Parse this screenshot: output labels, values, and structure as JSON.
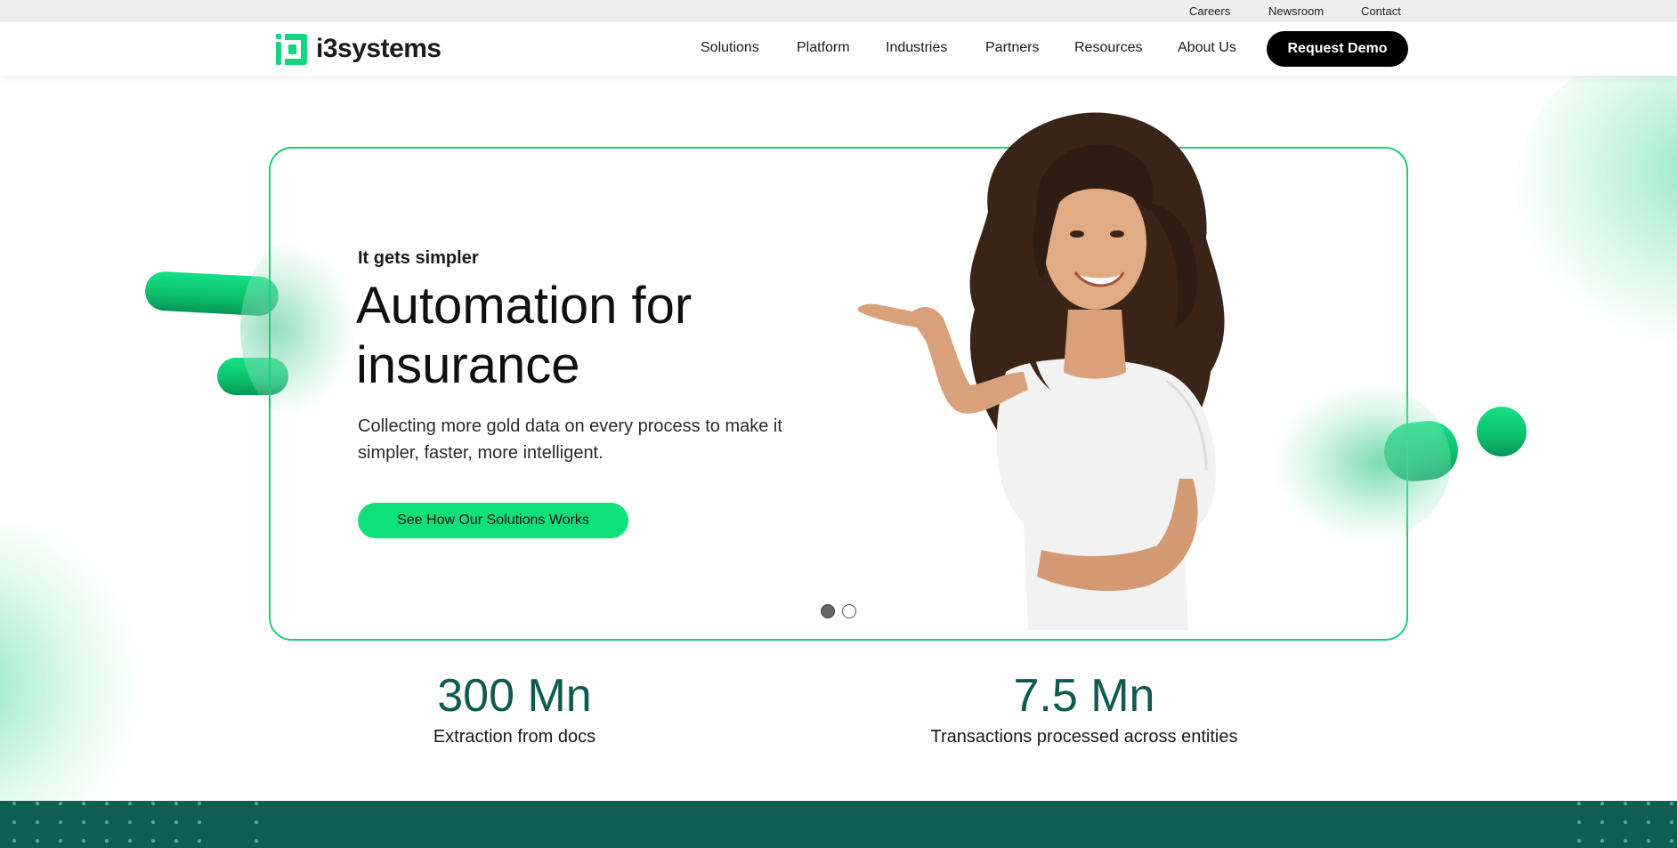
{
  "topbar": {
    "links": [
      "Careers",
      "Newsroom",
      "Contact"
    ]
  },
  "header": {
    "logo_text": "i3systems",
    "nav": [
      "Solutions",
      "Platform",
      "Industries",
      "Partners",
      "Resources",
      "About Us"
    ],
    "cta_label": "Request Demo"
  },
  "hero": {
    "eyebrow": "It gets simpler",
    "title": "Automation for insurance",
    "description": "Collecting more gold data on every process to make it simpler, faster, more intelligent.",
    "cta_label": "See How Our Solutions Works",
    "slides_total": 2,
    "active_slide": 1
  },
  "stats": [
    {
      "value": "300 Mn",
      "label": "Extraction from docs"
    },
    {
      "value": "7.5 Mn",
      "label": "Transactions processed across entities"
    }
  ],
  "colors": {
    "brand_green": "#0fe07a",
    "accent_teal": "#0e5e52",
    "card_border": "#1fcc7a",
    "stat_text": "#0f5a50"
  }
}
